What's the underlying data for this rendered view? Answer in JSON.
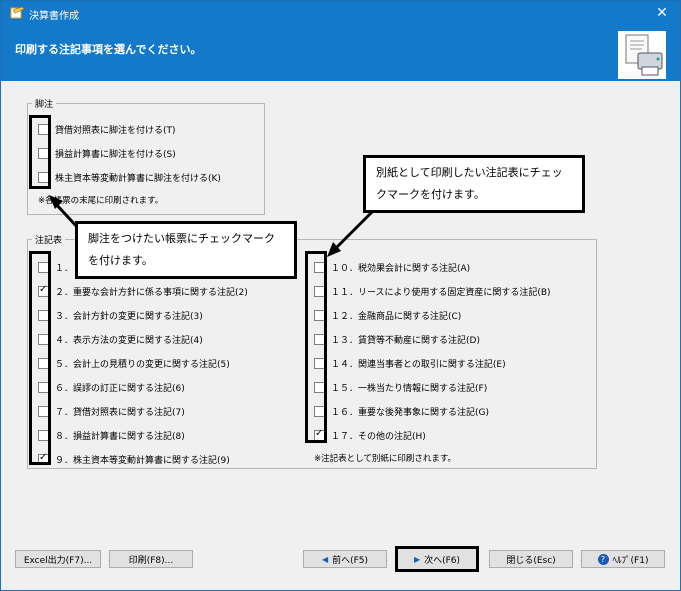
{
  "window": {
    "title": "決算書作成",
    "close_glyph": "✕"
  },
  "header": {
    "heading": "印刷する注記事項を選んでください。"
  },
  "footnote_group": {
    "title": "脚注",
    "items": [
      {
        "label": "貸借対照表に脚注を付ける(T)",
        "checked": false
      },
      {
        "label": "損益計算書に脚注を付ける(S)",
        "checked": false
      },
      {
        "label": "株主資本等変動計算書に脚注を付ける(K)",
        "checked": false
      }
    ],
    "note": "※各帳票の末尾に印刷されます。"
  },
  "notes_group": {
    "title": "注記表",
    "left_items": [
      {
        "label": "１．",
        "checked": false
      },
      {
        "label": "２．重要な会計方針に係る事項に関する注記(2)",
        "checked": true
      },
      {
        "label": "３．会計方針の変更に関する注記(3)",
        "checked": false
      },
      {
        "label": "４．表示方法の変更に関する注記(4)",
        "checked": false
      },
      {
        "label": "５．会計上の見積りの変更に関する注記(5)",
        "checked": false
      },
      {
        "label": "６．誤謬の訂正に関する注記(6)",
        "checked": false
      },
      {
        "label": "７．貸借対照表に関する注記(7)",
        "checked": false
      },
      {
        "label": "８．損益計算書に関する注記(8)",
        "checked": false
      },
      {
        "label": "９．株主資本等変動計算書に関する注記(9)",
        "checked": true
      }
    ],
    "right_items": [
      {
        "label": "１０．税効果会計に関する注記(A)",
        "checked": false
      },
      {
        "label": "１１．リースにより使用する固定資産に関する注記(B)",
        "checked": false
      },
      {
        "label": "１２．金融商品に関する注記(C)",
        "checked": false
      },
      {
        "label": "１３．賃貸等不動産に関する注記(D)",
        "checked": false
      },
      {
        "label": "１４．関連当事者との取引に関する注記(E)",
        "checked": false
      },
      {
        "label": "１５．一株当たり情報に関する注記(F)",
        "checked": false
      },
      {
        "label": "１６．重要な後発事象に関する注記(G)",
        "checked": false
      },
      {
        "label": "１７．その他の注記(H)",
        "checked": true
      }
    ],
    "note": "※注記表として別紙に印刷されます。"
  },
  "callouts": {
    "footnote": "脚注をつけたい帳票にチェックマークを付けます。",
    "notes": "別紙として印刷したい注記表にチェックマークを付けます。"
  },
  "buttons": {
    "excel": "Excel出力(F7)...",
    "print": "印刷(F8)...",
    "back": "前へ(F5)",
    "next": "次へ(F6)",
    "close": "閉じる(Esc)",
    "help": "ﾍﾙﾌﾟ(F1)"
  },
  "icons": {
    "app": "document-icon",
    "header_art": "printer-document-icon"
  }
}
